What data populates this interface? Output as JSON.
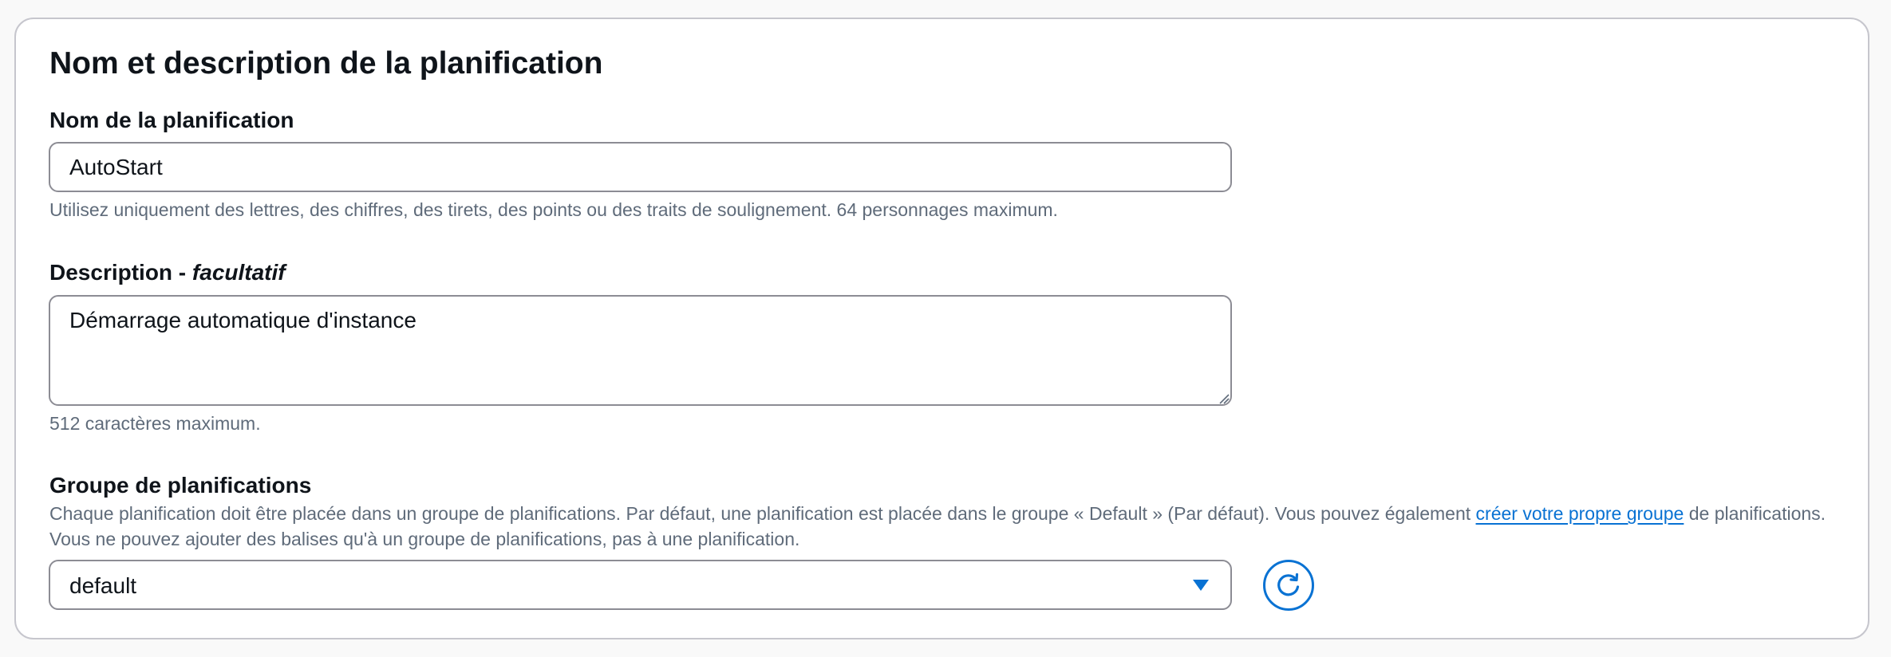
{
  "section": {
    "title": "Nom et description de la planification"
  },
  "name_field": {
    "label": "Nom de la planification",
    "value": "AutoStart",
    "hint": "Utilisez uniquement des lettres, des chiffres, des tirets, des points ou des traits de soulignement. 64 personnages maximum."
  },
  "description_field": {
    "label": "Description - ",
    "optional_label": "facultatif",
    "value": "Démarrage automatique d'instance",
    "hint": "512 caractères maximum."
  },
  "group_field": {
    "label": "Groupe de planifications",
    "desc_before": "Chaque planification doit être placée dans un groupe de planifications. Par défaut, une planification est placée dans le groupe « Default » (Par défaut). Vous pouvez également ",
    "link_text": "créer votre propre groupe",
    "desc_after": " de planifications. Vous ne pouvez ajouter des balises qu'à un groupe de planifications, pas à une planification.",
    "selected_value": "default",
    "caret_icon": "caret-down-icon",
    "refresh_icon": "refresh-icon"
  },
  "colors": {
    "link": "#0972d3",
    "accent": "#0972d3",
    "border": "#8c8c94",
    "hint_text": "#5f6b7a"
  }
}
